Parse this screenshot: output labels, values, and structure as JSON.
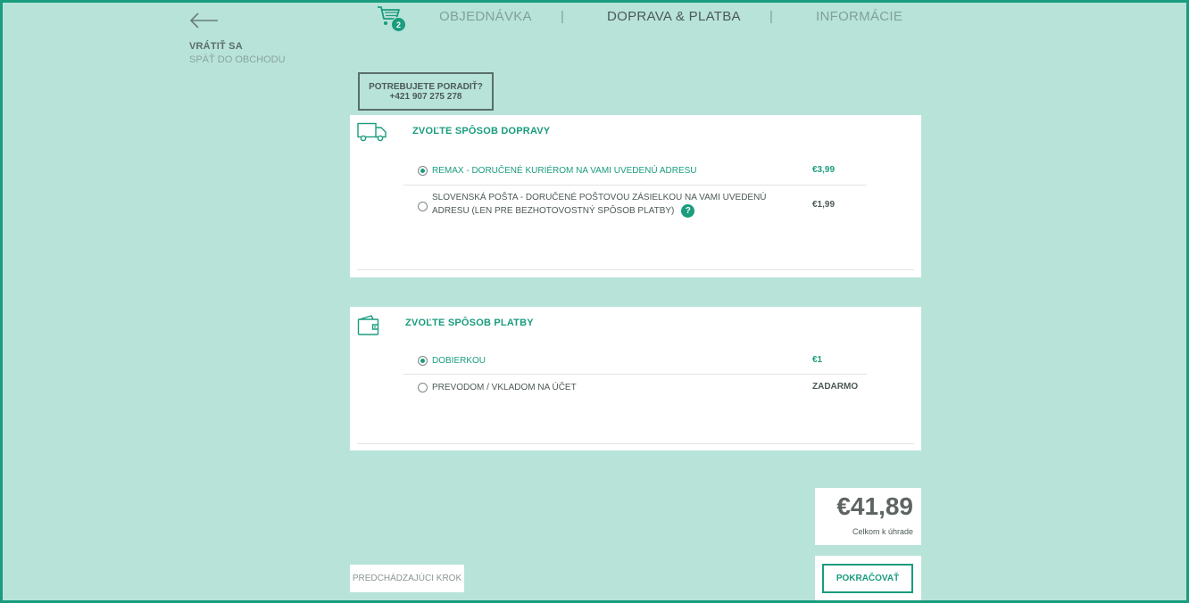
{
  "back": {
    "title": "VRÁTIŤ SA",
    "subtitle": "SPÄŤ DO OBCHODU"
  },
  "steps": {
    "cart_count": "2",
    "items": [
      {
        "label": "OBJEDNÁVKA",
        "state": "done"
      },
      {
        "label": "DOPRAVA & PLATBA",
        "state": "active"
      },
      {
        "label": "INFORMÁCIE",
        "state": "upcoming"
      }
    ],
    "separator": "|"
  },
  "help": {
    "line1": "POTREBUJETE PORADIŤ?",
    "line2": "+421 907 275 278"
  },
  "shipping": {
    "title": "ZVOĽTE SPÔSOB DOPRAVY",
    "options": [
      {
        "label": "REMAX - DORUČENÉ KURIÉROM NA VAMI UVEDENÚ ADRESU",
        "price": "€3,99",
        "selected": true
      },
      {
        "label": "SLOVENSKÁ POŠTA - DORUČENÉ POŠTOVOU ZÁSIELKOU NA VAMI UVEDENÚ ADRESU (LEN PRE BEZHOTOVOSTNÝ SPÔSOB PLATBY)",
        "price": "€1,99",
        "selected": false,
        "help": "?"
      }
    ]
  },
  "payment": {
    "title": "ZVOĽTE SPÔSOB PLATBY",
    "options": [
      {
        "label": "DOBIERKOU",
        "price": "€1",
        "selected": true
      },
      {
        "label": "PREVODOM / VKLADOM NA ÚČET",
        "price": "ZADARMO",
        "selected": false
      }
    ]
  },
  "total": {
    "amount": "€41,89",
    "label": "Celkom k úhrade"
  },
  "buttons": {
    "previous": "PREDCHÁDZAJÚCI KROK",
    "continue": "POKRAČOVAŤ"
  },
  "colors": {
    "accent": "#1a9c7e",
    "background": "#b8e3d9",
    "text": "#4c5a56"
  },
  "icons": {
    "back": "arrow-left-icon",
    "cart": "cart-icon",
    "shipping": "truck-icon",
    "payment": "wallet-icon",
    "help": "question-icon"
  }
}
